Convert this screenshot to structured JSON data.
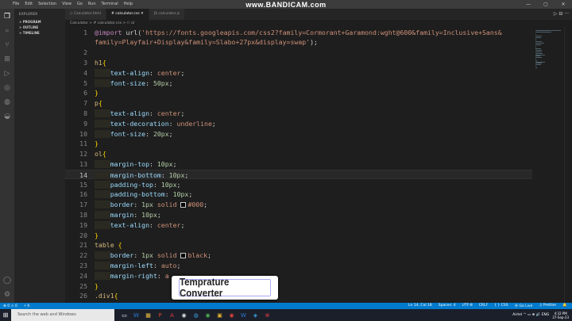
{
  "menu": [
    "File",
    "Edit",
    "Selection",
    "View",
    "Go",
    "Run",
    "Terminal",
    "Help"
  ],
  "watermark": "www.BANDICAM.com",
  "window_controls": [
    "—",
    "▢",
    "✕"
  ],
  "sidebar": {
    "header": "EXPLORER",
    "rows": [
      "> PROGRAM",
      "> OUTLINE",
      "> TIMELINE"
    ]
  },
  "tabs": [
    {
      "label": "◇ Calculator.html",
      "active": false
    },
    {
      "label": "# calculator.css ✕",
      "active": true
    },
    {
      "label": "JS calculator.js",
      "active": false
    }
  ],
  "tab_actions": "▷ ⊟ ···",
  "breadcrumb": "Calculator > # calculator.css > ⚇ ol",
  "code_lines": [
    {
      "n": "1",
      "parts": [
        [
          "c-at",
          "@import "
        ],
        [
          "c-punc",
          "url("
        ],
        [
          "c-str",
          "'https://fonts.googleapis.com/css2?family=Cormorant+Garamond:wght@600&family=Inclusive+Sans&"
        ]
      ]
    },
    {
      "n": "",
      "parts": [
        [
          "c-str",
          "family=Playfair+Display&family=Slabo+27px&display=swap'"
        ],
        [
          "c-punc",
          ");"
        ]
      ]
    },
    {
      "n": "2",
      "parts": []
    },
    {
      "n": "3",
      "parts": [
        [
          "c-sel",
          "h1"
        ],
        [
          "c-brace",
          "{"
        ]
      ]
    },
    {
      "n": "4",
      "parts": [
        [
          "indent",
          "    "
        ],
        [
          "c-prop",
          "text-align"
        ],
        [
          "c-punc",
          ": "
        ],
        [
          "c-val",
          "center"
        ],
        [
          "c-punc",
          ";"
        ]
      ]
    },
    {
      "n": "5",
      "parts": [
        [
          "indent",
          "    "
        ],
        [
          "c-prop",
          "font-size"
        ],
        [
          "c-punc",
          ": "
        ],
        [
          "c-num",
          "50px"
        ],
        [
          "c-punc",
          ";"
        ]
      ]
    },
    {
      "n": "6",
      "parts": [
        [
          "c-brace",
          "}"
        ]
      ]
    },
    {
      "n": "7",
      "parts": [
        [
          "c-sel",
          "p"
        ],
        [
          "c-brace",
          "{"
        ]
      ]
    },
    {
      "n": "8",
      "parts": [
        [
          "indent",
          "    "
        ],
        [
          "c-prop",
          "text-align"
        ],
        [
          "c-punc",
          ": "
        ],
        [
          "c-val",
          "center"
        ],
        [
          "c-punc",
          ";"
        ]
      ]
    },
    {
      "n": "9",
      "parts": [
        [
          "indent",
          "    "
        ],
        [
          "c-prop",
          "text-decoration"
        ],
        [
          "c-punc",
          ": "
        ],
        [
          "c-val",
          "underline"
        ],
        [
          "c-punc",
          ";"
        ]
      ]
    },
    {
      "n": "10",
      "parts": [
        [
          "indent",
          "    "
        ],
        [
          "c-prop",
          "font-size"
        ],
        [
          "c-punc",
          ": "
        ],
        [
          "c-num",
          "20px"
        ],
        [
          "c-punc",
          ";"
        ]
      ]
    },
    {
      "n": "11",
      "parts": [
        [
          "c-brace",
          "}"
        ]
      ]
    },
    {
      "n": "12",
      "parts": [
        [
          "c-sel",
          "ol"
        ],
        [
          "c-brace",
          "{"
        ]
      ]
    },
    {
      "n": "13",
      "parts": [
        [
          "indent",
          "    "
        ],
        [
          "c-prop",
          "margin-top"
        ],
        [
          "c-punc",
          ": "
        ],
        [
          "c-num",
          "10px"
        ],
        [
          "c-punc",
          ";"
        ]
      ]
    },
    {
      "n": "14",
      "current": true,
      "parts": [
        [
          "indent",
          "    "
        ],
        [
          "c-prop",
          "margin-bottom"
        ],
        [
          "c-punc",
          ": "
        ],
        [
          "c-num",
          "10px"
        ],
        [
          "c-punc",
          ";"
        ]
      ]
    },
    {
      "n": "15",
      "parts": [
        [
          "indent",
          "    "
        ],
        [
          "c-prop",
          "padding-top"
        ],
        [
          "c-punc",
          ": "
        ],
        [
          "c-num",
          "10px"
        ],
        [
          "c-punc",
          ";"
        ]
      ]
    },
    {
      "n": "16",
      "parts": [
        [
          "indent",
          "    "
        ],
        [
          "c-prop",
          "padding-bottom"
        ],
        [
          "c-punc",
          ": "
        ],
        [
          "c-num",
          "10px"
        ],
        [
          "c-punc",
          ";"
        ]
      ]
    },
    {
      "n": "17",
      "parts": [
        [
          "indent",
          "    "
        ],
        [
          "c-prop",
          "border"
        ],
        [
          "c-punc",
          ": "
        ],
        [
          "c-num",
          "1px "
        ],
        [
          "c-val",
          "solid "
        ],
        [
          "swatch",
          "#000000"
        ],
        [
          "c-val",
          "#000"
        ],
        [
          "c-punc",
          ";"
        ]
      ]
    },
    {
      "n": "18",
      "parts": [
        [
          "indent",
          "    "
        ],
        [
          "c-prop",
          "margin"
        ],
        [
          "c-punc",
          ": "
        ],
        [
          "c-num",
          "10px"
        ],
        [
          "c-punc",
          ";"
        ]
      ]
    },
    {
      "n": "19",
      "parts": [
        [
          "indent",
          "    "
        ],
        [
          "c-prop",
          "text-align"
        ],
        [
          "c-punc",
          ": "
        ],
        [
          "c-val",
          "center"
        ],
        [
          "c-punc",
          ";"
        ]
      ]
    },
    {
      "n": "20",
      "parts": [
        [
          "c-brace",
          "}"
        ]
      ]
    },
    {
      "n": "21",
      "parts": [
        [
          "c-sel",
          "table "
        ],
        [
          "c-brace",
          "{"
        ]
      ]
    },
    {
      "n": "22",
      "parts": [
        [
          "indent",
          "    "
        ],
        [
          "c-prop",
          "border"
        ],
        [
          "c-punc",
          ": "
        ],
        [
          "c-num",
          "1px "
        ],
        [
          "c-val",
          "solid "
        ],
        [
          "swatch",
          "#000000"
        ],
        [
          "c-val",
          "black"
        ],
        [
          "c-punc",
          ";"
        ]
      ]
    },
    {
      "n": "23",
      "parts": [
        [
          "indent",
          "    "
        ],
        [
          "c-prop",
          "margin-left"
        ],
        [
          "c-punc",
          ": "
        ],
        [
          "c-val",
          "auto"
        ],
        [
          "c-punc",
          ";"
        ]
      ]
    },
    {
      "n": "24",
      "parts": [
        [
          "indent",
          "    "
        ],
        [
          "c-prop",
          "margin-right"
        ],
        [
          "c-punc",
          ": "
        ],
        [
          "c-val",
          "a"
        ]
      ]
    },
    {
      "n": "25",
      "parts": [
        [
          "c-brace",
          "}"
        ]
      ]
    },
    {
      "n": "26",
      "parts": [
        [
          "c-sel",
          ".div1"
        ],
        [
          "c-brace",
          "{"
        ]
      ]
    }
  ],
  "banner_text": "Temprature Converter",
  "status": {
    "left": [
      "⊗ 0 ⚠ 0",
      "⚡ 0"
    ],
    "right": [
      "Ln 14, Col 18",
      "Spaces: 4",
      "UTF-8",
      "CRLF",
      "{ } CSS",
      "⦿ Go Live",
      "♫ Prettier",
      "🔔"
    ]
  },
  "taskbar": {
    "search_placeholder": "Search the web and Windows",
    "apps": [
      {
        "glyph": "▭",
        "color": "#ffffff"
      },
      {
        "glyph": "W",
        "color": "#2b7cd3"
      },
      {
        "glyph": "▦",
        "color": "#f0c040"
      },
      {
        "glyph": "P",
        "color": "#d24726"
      },
      {
        "glyph": "A",
        "color": "#e03a3a"
      },
      {
        "glyph": "◉",
        "color": "#dddddd"
      },
      {
        "glyph": "◍",
        "color": "#3aa0e0"
      },
      {
        "glyph": "◉",
        "color": "#4caf50"
      },
      {
        "glyph": "▣",
        "color": "#e0b030"
      },
      {
        "glyph": "◉",
        "color": "#e04040"
      },
      {
        "glyph": "W",
        "color": "#2b7cd3"
      },
      {
        "glyph": "◈",
        "color": "#3aa0e0"
      },
      {
        "glyph": "⊗",
        "color": "#e04040"
      }
    ],
    "tray": "Airtel  ^  ▭  ⊕  🔊  ENG",
    "time": "4:32 PM",
    "date": "27-Sep-23"
  }
}
